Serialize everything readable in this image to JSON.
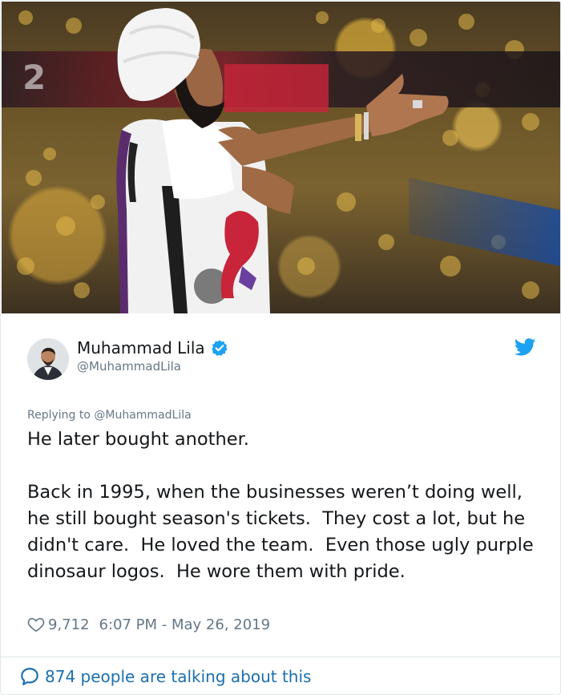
{
  "media": {
    "scoreboard_number": "2",
    "icon": "photo-basketball-fan"
  },
  "tweet": {
    "author": {
      "display_name": "Muhammad Lila",
      "screen_name": "@MuhammadLila",
      "verified": true
    },
    "replying_prefix": "Replying to",
    "replying_to": "@MuhammadLila",
    "text": "He later bought another.\n\nBack in 1995, when the businesses weren’t doing well, he still bought season's tickets.  They cost a lot, but he didn't care.  He loved the team.  Even those ugly purple dinosaur logos.  He wore them with pride.",
    "likes": "9,712",
    "timestamp": "6:07 PM - May 26, 2019",
    "conversation": "874 people are talking about this"
  },
  "colors": {
    "link_blue": "#1b6fb0",
    "twitter_blue": "#1da1f2",
    "secondary_text": "#657786"
  },
  "icons": [
    "verified-badge-icon",
    "twitter-bird-icon",
    "heart-icon",
    "speech-bubble-icon"
  ]
}
